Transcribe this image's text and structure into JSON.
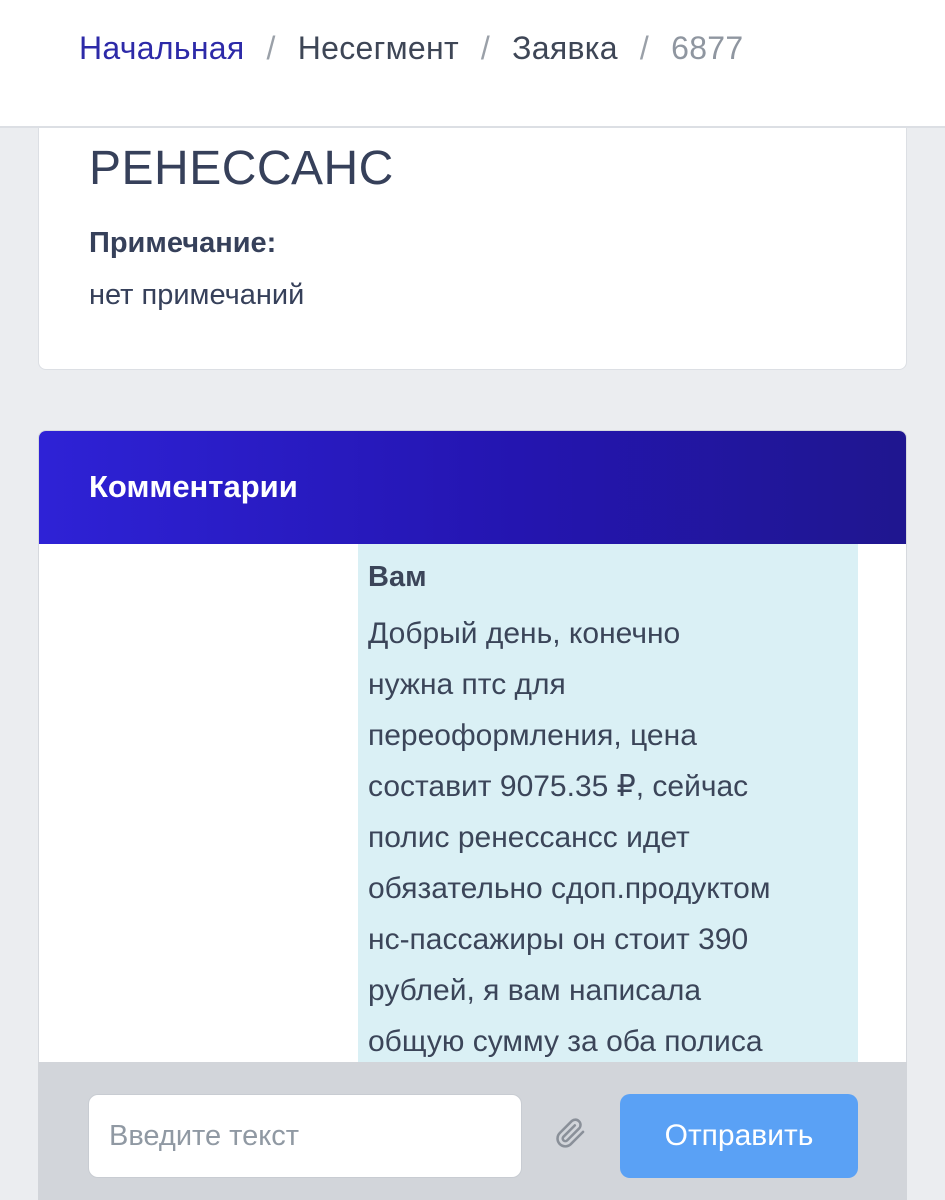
{
  "breadcrumb": {
    "home": "Начальная",
    "items": [
      "Несегмент",
      "Заявка"
    ],
    "current": "6877",
    "separator": "/"
  },
  "details": {
    "insurer": "РЕНЕССАНС",
    "note_label": "Примечание:",
    "note_value": "нет примечаний"
  },
  "comments": {
    "title": "Комментарии",
    "messages": [
      {
        "author": "Вам",
        "text": "Добрый день, конечно\nнужна птс для\nпереоформления, цена\nсоставит 9075.35 ₽, сейчас\nполис ренессансс идет\nобязательно сдоп.продуктом\nнс-пассажиры он стоит 390\nрублей, я вам написала\nобщую сумму за оба полиса"
      }
    ]
  },
  "composer": {
    "placeholder": "Введите текст",
    "send_label": "Отправить",
    "attach_icon": "paperclip-icon"
  },
  "colors": {
    "brand": "#2e22d6",
    "link": "#2d2aa8",
    "bubble": "#daf0f5",
    "send_button": "#5aa1f5"
  }
}
